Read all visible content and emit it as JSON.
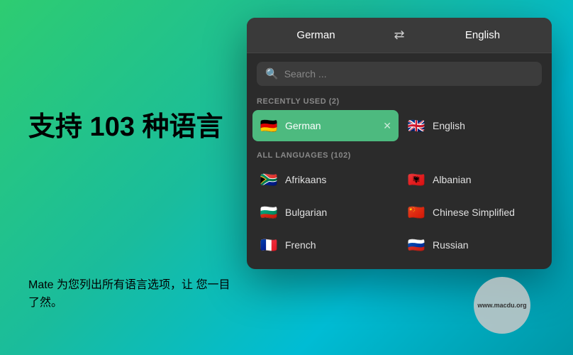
{
  "background": {
    "gradient_start": "#2ecc71",
    "gradient_end": "#0097a7"
  },
  "left": {
    "main_title": "支持 103 种语言",
    "sub_text": "Mate 为您列出所有语言选项，让\n您一目了然。"
  },
  "panel": {
    "source_language": "German",
    "target_language": "English",
    "swap_icon": "⇄",
    "search_placeholder": "Search ...",
    "recently_used_label": "RECENTLY USED (2)",
    "all_languages_label": "ALL LANGUAGES (102)",
    "recently_used": [
      {
        "name": "German",
        "flag": "🇩🇪",
        "selected": true
      },
      {
        "name": "English",
        "flag": "🇬🇧",
        "selected": false
      }
    ],
    "all_languages": [
      {
        "name": "Afrikaans",
        "flag": "🇿🇦"
      },
      {
        "name": "Albanian",
        "flag": "🇦🇱"
      },
      {
        "name": "Bulgarian",
        "flag": "🇧🇬"
      },
      {
        "name": "Chinese Simplified",
        "flag": "🇨🇳"
      },
      {
        "name": "French",
        "flag": "🇫🇷"
      },
      {
        "name": "Russian",
        "flag": "🇷🇺"
      }
    ]
  },
  "watermark": {
    "line1": "www.macdu.org"
  }
}
